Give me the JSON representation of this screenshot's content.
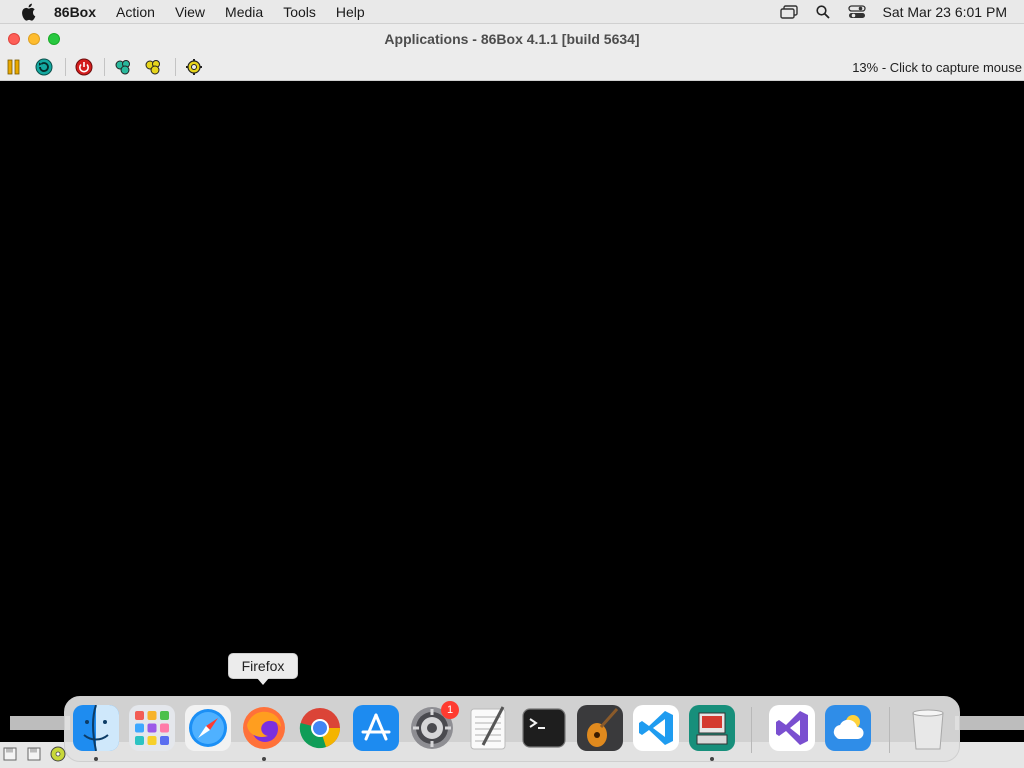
{
  "menubar": {
    "apple_icon": "apple-logo-icon",
    "app_name": "86Box",
    "items": [
      "Action",
      "View",
      "Media",
      "Tools",
      "Help"
    ],
    "status_icons": [
      "window-stack-icon",
      "search-icon",
      "control-center-icon"
    ],
    "clock": "Sat Mar 23  6:01 PM"
  },
  "window": {
    "title": "Applications - 86Box 4.1.1 [build 5634]"
  },
  "toolbar": {
    "buttons": [
      "pause-icon",
      "reset-icon",
      "power-icon",
      "ctrl-alt-del-icon",
      "ctrl-alt-esc-icon",
      "settings-icon"
    ],
    "capture_status": "13% - Click to capture mouse"
  },
  "statusbar": {
    "icons": [
      "floppy-drive-icon",
      "floppy-drive-2-icon",
      "cdrom-icon"
    ]
  },
  "dock": {
    "tooltip": "Firefox",
    "apps": [
      {
        "name": "Finder",
        "icon": "finder-icon",
        "running": true
      },
      {
        "name": "Launchpad",
        "icon": "launchpad-icon",
        "running": false
      },
      {
        "name": "Safari",
        "icon": "safari-icon",
        "running": false
      },
      {
        "name": "Firefox",
        "icon": "firefox-icon",
        "running": true
      },
      {
        "name": "Google Chrome",
        "icon": "chrome-icon",
        "running": false
      },
      {
        "name": "App Store",
        "icon": "app-store-icon",
        "running": false
      },
      {
        "name": "System Preferences",
        "icon": "system-preferences-icon",
        "running": false,
        "badge": "1"
      },
      {
        "name": "TextEdit",
        "icon": "textedit-icon",
        "running": false
      },
      {
        "name": "Terminal",
        "icon": "terminal-icon",
        "running": false
      },
      {
        "name": "GarageBand",
        "icon": "garageband-icon",
        "running": false
      },
      {
        "name": "Visual Studio Code",
        "icon": "vscode-icon",
        "running": false
      },
      {
        "name": "86Box",
        "icon": "86box-icon",
        "running": true
      },
      {
        "name": "Visual Studio",
        "icon": "visual-studio-icon",
        "running": false
      },
      {
        "name": "Weather",
        "icon": "weather-icon",
        "running": false
      },
      {
        "name": "Trash",
        "icon": "trash-icon",
        "running": false
      }
    ]
  }
}
